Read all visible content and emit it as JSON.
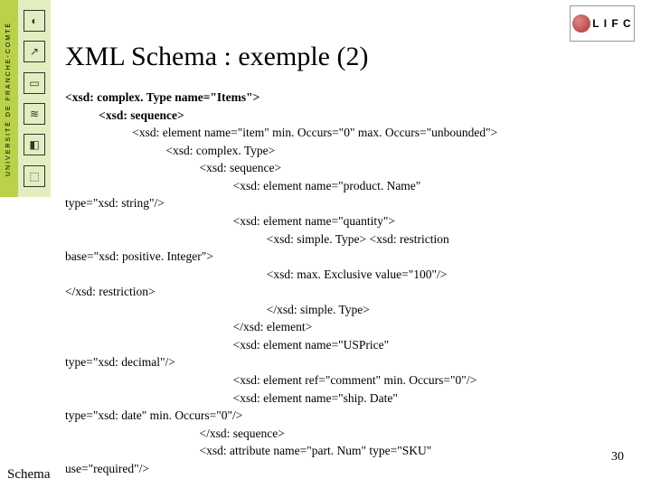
{
  "sidebar": {
    "label": "UNIVERSITÉ DE FRANCHE-COMTÉ",
    "icons": [
      "◐",
      "↗",
      "▭",
      "≋",
      "◧",
      "⬚"
    ]
  },
  "logo": {
    "text": "L I F C"
  },
  "title": "XML Schema : exemple (2)",
  "code": {
    "l01a": "<xsd: complex. Type name=\"Items\">",
    "l02": "           <xsd: sequence>",
    "l03": "                      <xsd: element name=\"item\" min. Occurs=\"0\" max. Occurs=\"unbounded\">",
    "l04": "                                 <xsd: complex. Type>",
    "l05": "                                            <xsd: sequence>",
    "l06": "                                                       <xsd: element name=\"product. Name\"",
    "l06b": "type=\"xsd: string\"/>",
    "l07": "                                                       <xsd: element name=\"quantity\">",
    "l08": "                                                                  <xsd: simple. Type> <xsd: restriction",
    "l08b": "base=\"xsd: positive. Integer\">",
    "l09": "                                                                  <xsd: max. Exclusive value=\"100\"/>",
    "l09b": "</xsd: restriction>",
    "l10": "                                                                  </xsd: simple. Type>",
    "l11": "                                                       </xsd: element>",
    "l12": "                                                       <xsd: element name=\"USPrice\"",
    "l12b": "type=\"xsd: decimal\"/>",
    "l13": "                                                       <xsd: element ref=\"comment\" min. Occurs=\"0\"/>",
    "l14": "                                                       <xsd: element name=\"ship. Date\"",
    "l14b": "type=\"xsd: date\" min. Occurs=\"0\"/>",
    "l15": "                                            </xsd: sequence>",
    "l16": "                                            <xsd: attribute name=\"part. Num\" type=\"SKU\"",
    "l16b": "use=\"required\"/>"
  },
  "footer": "Schema",
  "pagenum": "30"
}
